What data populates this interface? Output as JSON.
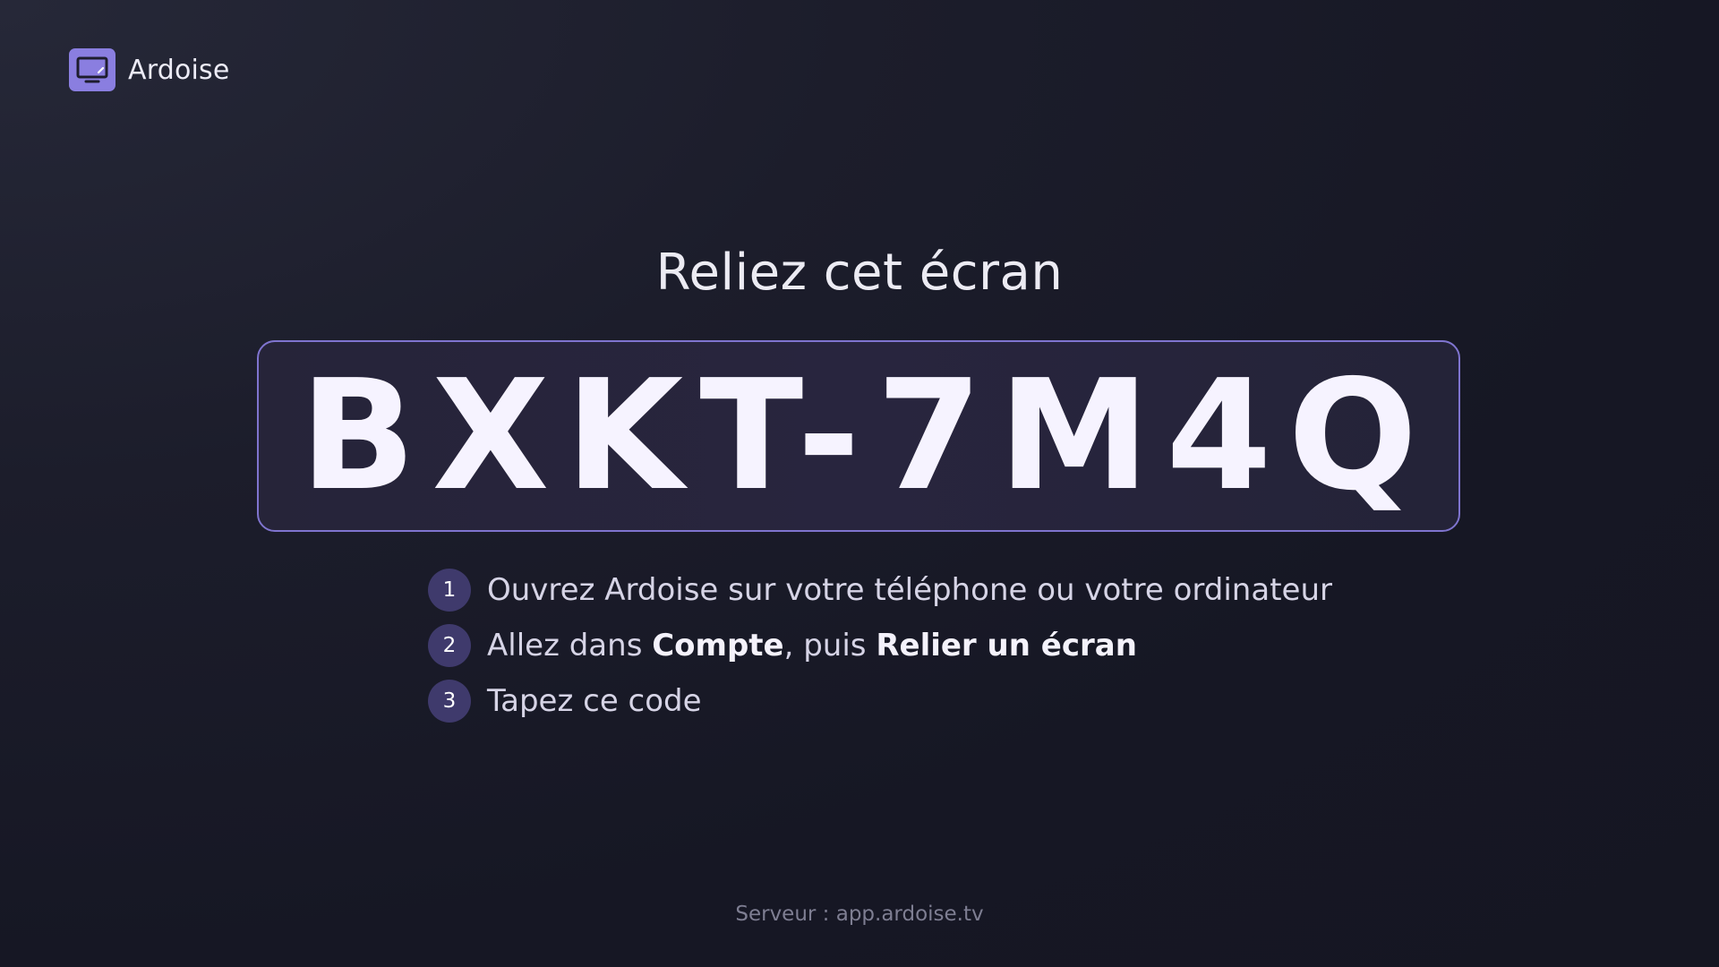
{
  "brand": {
    "name": "Ardoise",
    "icon": "tv-screen-icon",
    "accent_color": "#8a7ee0"
  },
  "heading": "Reliez cet écran",
  "pairing_code": "BXKT-7M4Q",
  "steps": [
    {
      "number": "1",
      "text_before": "Ouvrez Ardoise sur votre téléphone ou votre ordinateur"
    },
    {
      "number": "2",
      "text_before": "Allez dans ",
      "bold_1": "Compte",
      "text_middle": ", puis ",
      "bold_2": "Relier un écran"
    },
    {
      "number": "3",
      "text_before": "Tapez ce code"
    }
  ],
  "footer": "Serveur : app.ardoise.tv",
  "colors": {
    "background": "#161724",
    "code_border": "#7f74cf",
    "step_badge": "#3f3a6c"
  }
}
